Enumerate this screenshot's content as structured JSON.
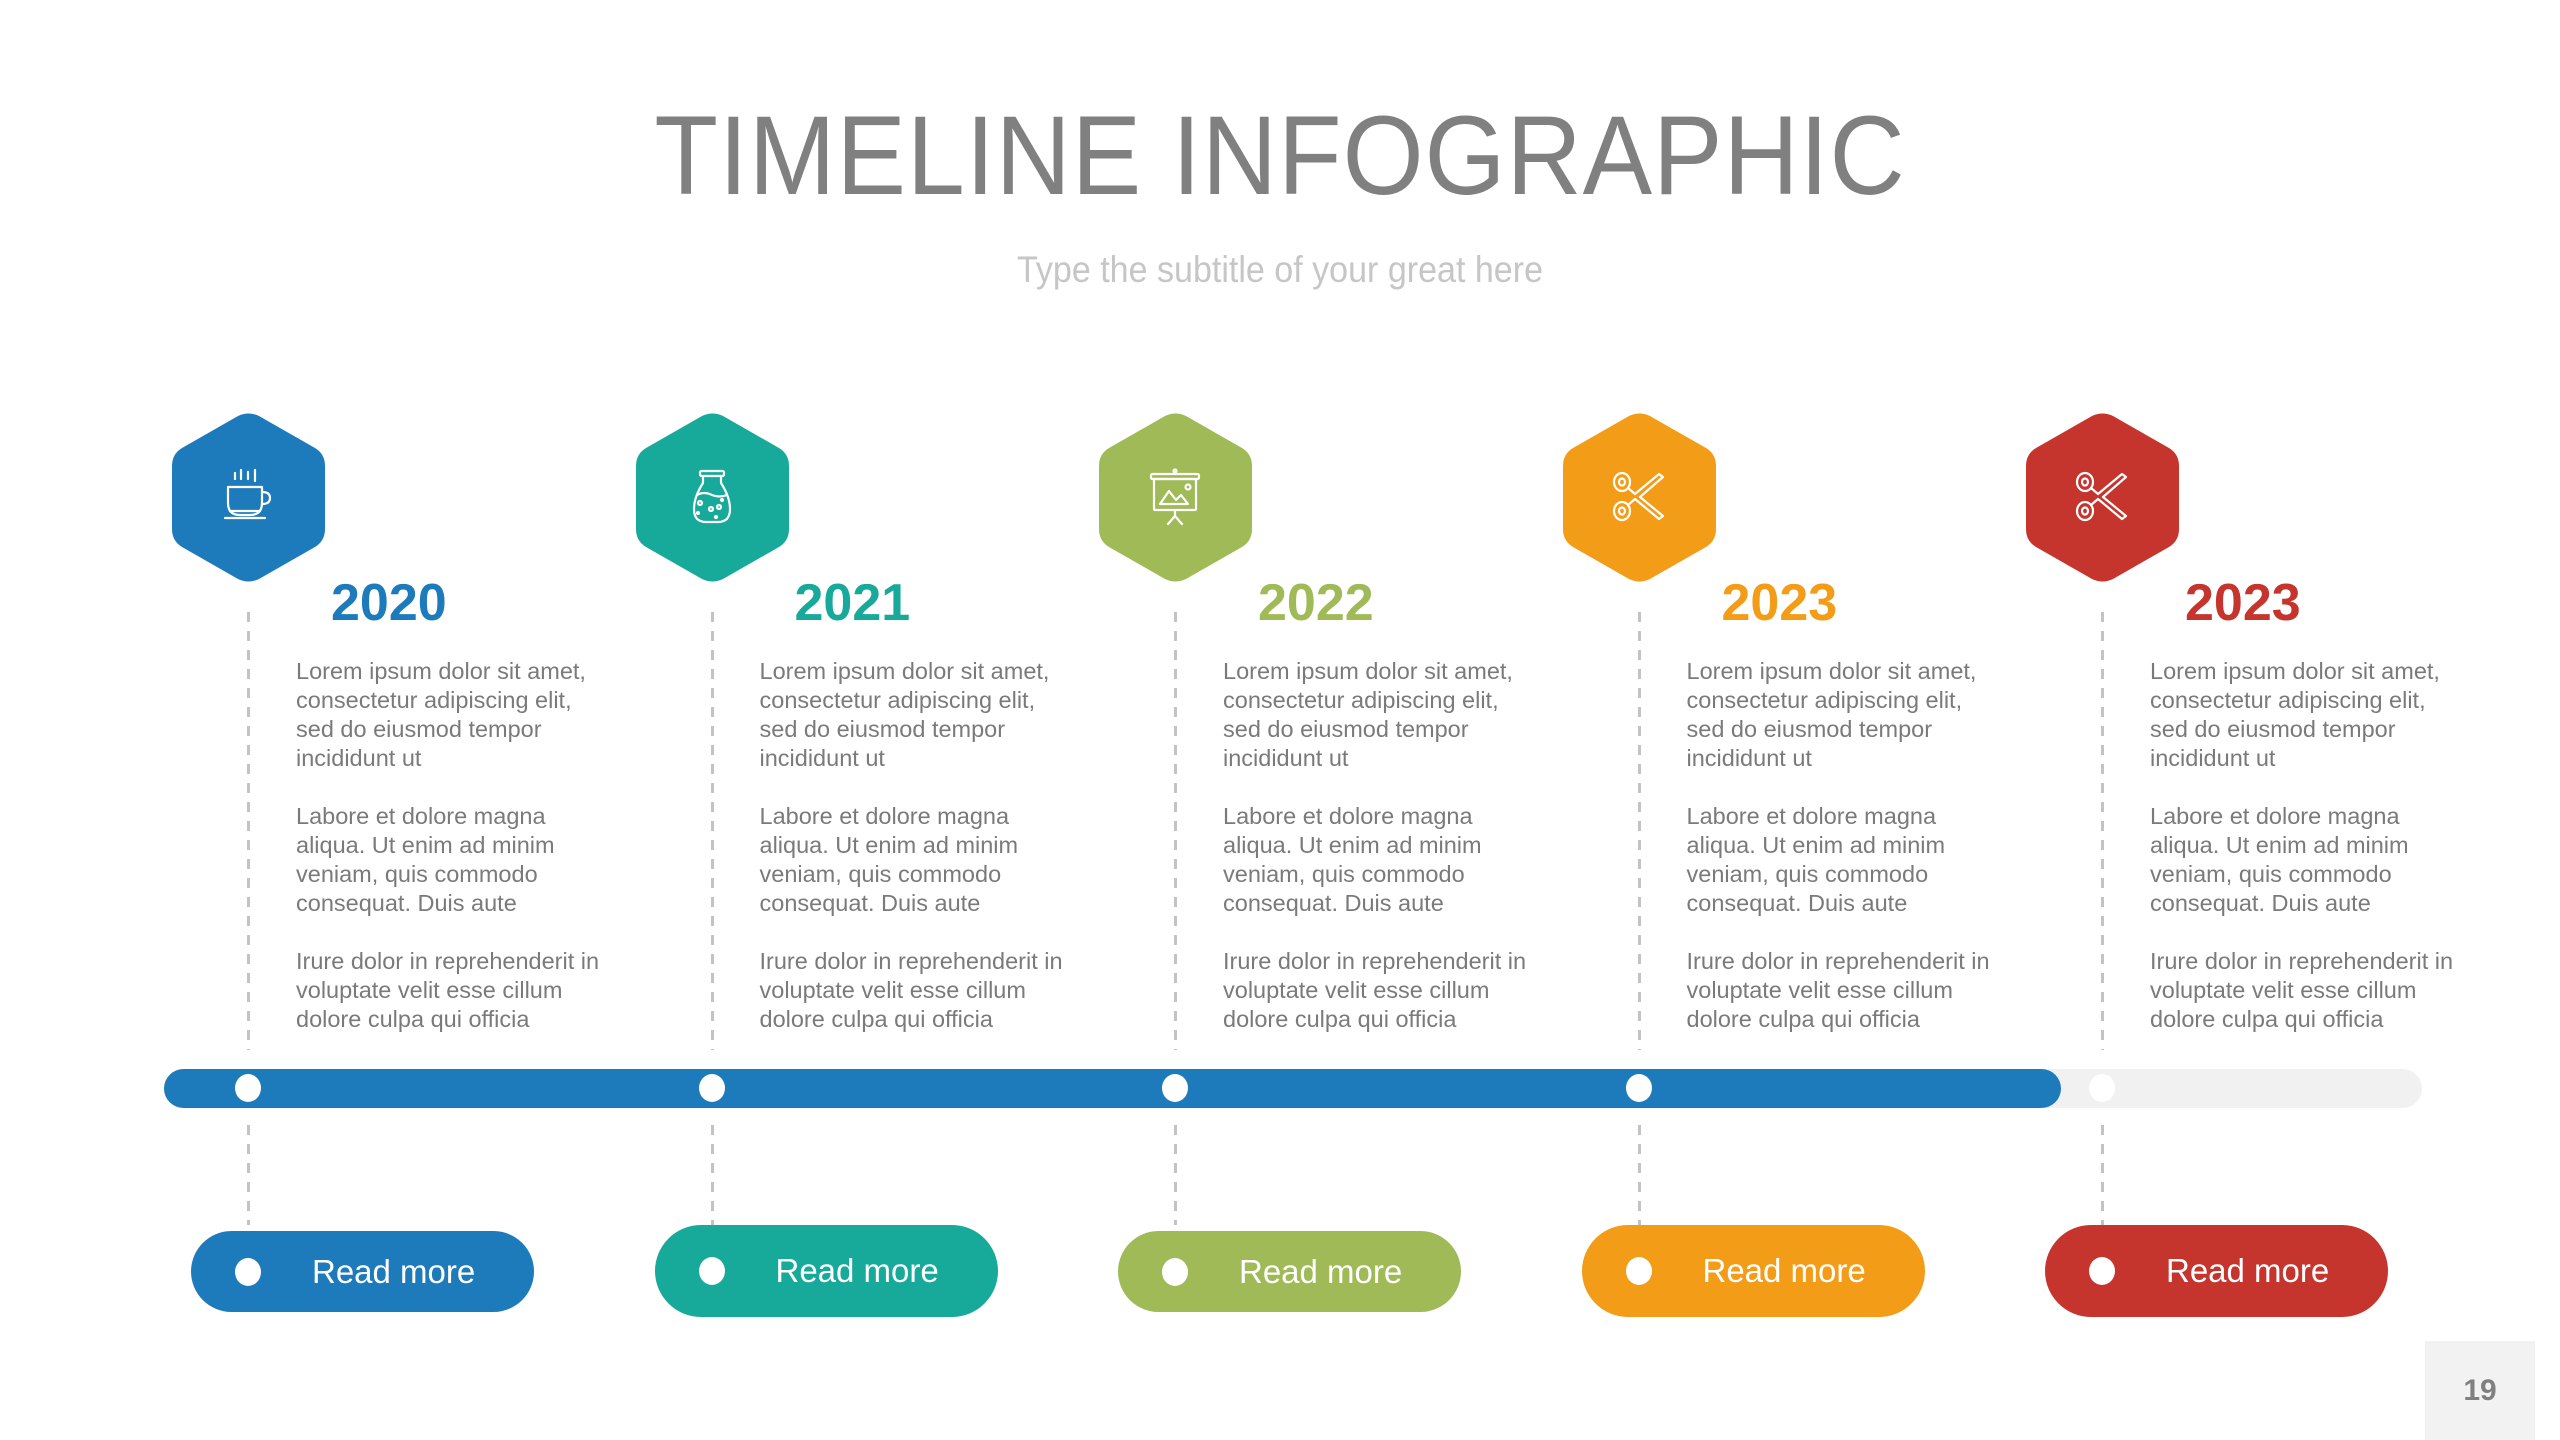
{
  "slide": {
    "title": "TIMELINE INFOGRAPHIC",
    "subtitle": "Type the subtitle of your great here",
    "page_number": "19"
  },
  "timeline": {
    "progress_percent": 84,
    "track_color": "#f1f1f1",
    "fill_color": "#1e7bbb",
    "milestones": [
      {
        "year": "2020",
        "color": "#1e7bbb",
        "icon": "coffee-cup-icon",
        "paragraphs": [
          "Lorem ipsum dolor sit amet,\nconsectetur adipiscing elit,\nsed do eiusmod tempor\nincididunt ut",
          "Labore et dolore magna\naliqua. Ut enim ad minim\nveniam, quis commodo\nconsequat. Duis aute",
          "Irure dolor in reprehenderit in\nvoluptate velit esse cillum\ndolore culpa qui officia"
        ],
        "button_label": "Read more"
      },
      {
        "year": "2021",
        "color": "#17a99a",
        "icon": "potion-flask-icon",
        "paragraphs": [
          "Lorem ipsum dolor sit amet,\nconsectetur adipiscing elit,\nsed do eiusmod tempor\nincididunt ut",
          "Labore et dolore magna\naliqua. Ut enim ad minim\nveniam, quis commodo\nconsequat. Duis aute",
          "Irure dolor in reprehenderit in\nvoluptate velit esse cillum\ndolore culpa qui officia"
        ],
        "button_label": "Read more"
      },
      {
        "year": "2022",
        "color": "#9fba56",
        "icon": "presentation-board-icon",
        "paragraphs": [
          "Lorem ipsum dolor sit amet,\nconsectetur adipiscing elit,\nsed do eiusmod tempor\nincididunt ut",
          "Labore et dolore magna\naliqua. Ut enim ad minim\nveniam, quis commodo\nconsequat. Duis aute",
          "Irure dolor in reprehenderit in\nvoluptate velit esse cillum\ndolore culpa qui officia"
        ],
        "button_label": "Read more"
      },
      {
        "year": "2023",
        "color": "#f39c17",
        "icon": "scissors-icon",
        "paragraphs": [
          "Lorem ipsum dolor sit amet,\nconsectetur adipiscing elit,\nsed do eiusmod tempor\nincididunt ut",
          "Labore et dolore magna\naliqua. Ut enim ad minim\nveniam, quis commodo\nconsequat. Duis aute",
          "Irure dolor in reprehenderit in\nvoluptate velit esse cillum\ndolore culpa qui officia"
        ],
        "button_label": "Read more"
      },
      {
        "year": "2023",
        "color": "#c5352e",
        "icon": "scissors-icon",
        "paragraphs": [
          "Lorem ipsum dolor sit amet,\nconsectetur adipiscing elit,\nsed do eiusmod tempor\nincididunt ut",
          "Labore et dolore magna\naliqua. Ut enim ad minim\nveniam, quis commodo\nconsequat. Duis aute",
          "Irure dolor in reprehenderit in\nvoluptate velit esse cillum\ndolore culpa qui officia"
        ],
        "button_label": "Read more"
      }
    ]
  }
}
